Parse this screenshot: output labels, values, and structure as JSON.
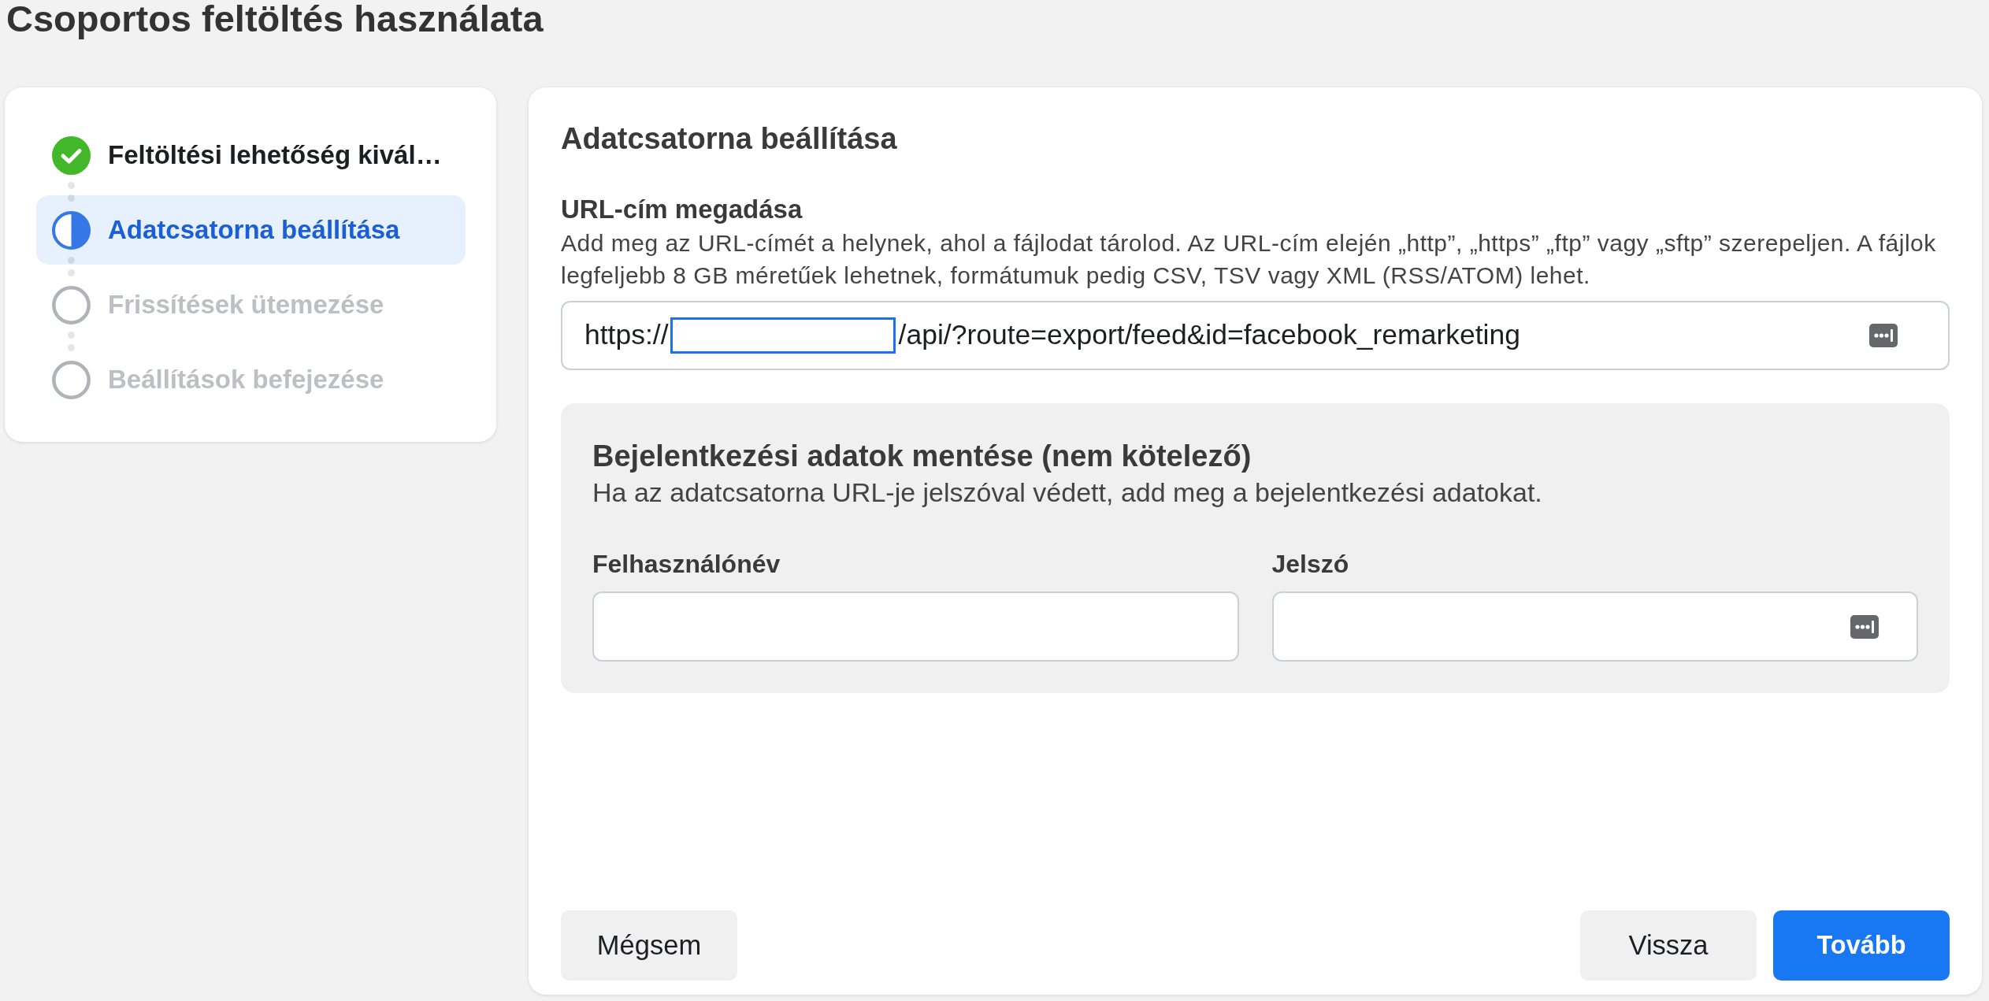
{
  "page_title": "Csoportos feltöltés használata",
  "steps": [
    {
      "label": "Feltöltési lehetőség kivál…",
      "kind": "done",
      "selected": false
    },
    {
      "label": "Adatcsatorna beállítása",
      "kind": "current",
      "selected": true
    },
    {
      "label": "Frissítések ütemezése",
      "kind": "pending",
      "selected": false
    },
    {
      "label": "Beállítások befejezése",
      "kind": "pending",
      "selected": false
    }
  ],
  "panel": {
    "title": "Adatcsatorna beállítása",
    "url_section": {
      "label": "URL-cím megadása",
      "description": "Add meg az URL-címét a helynek, ahol a fájlodat tárolod. Az URL-cím elején „http”, „https” „ftp” vagy „sftp” szerepeljen. A fájlok legfeljebb 8 GB méretűek lehetnek, formátumuk pedig CSV, TSV vagy XML (RSS/ATOM) lehet.",
      "field": {
        "value_parts": [
          "https://",
          "/api/?route=export/feed&id=facebook_remarketing"
        ],
        "autofill_icon": true
      }
    }
  },
  "login": {
    "title": "Bejelentkezési adatok mentése (nem kötelező)",
    "description": "Ha az adatcsatorna URL-je jelszóval védett, add meg a bejelentkezési adatokat.",
    "fields": [
      {
        "label": "Felhasználónév",
        "autofill_icon": false
      },
      {
        "label": "Jelszó",
        "autofill_icon": true
      }
    ]
  },
  "footer": {
    "left_buttons": [
      {
        "label": "Mégsem",
        "kind": "secondary"
      }
    ],
    "right_buttons": [
      {
        "label": "Vissza",
        "kind": "secondary"
      },
      {
        "label": "Tovább",
        "kind": "primary"
      }
    ]
  }
}
